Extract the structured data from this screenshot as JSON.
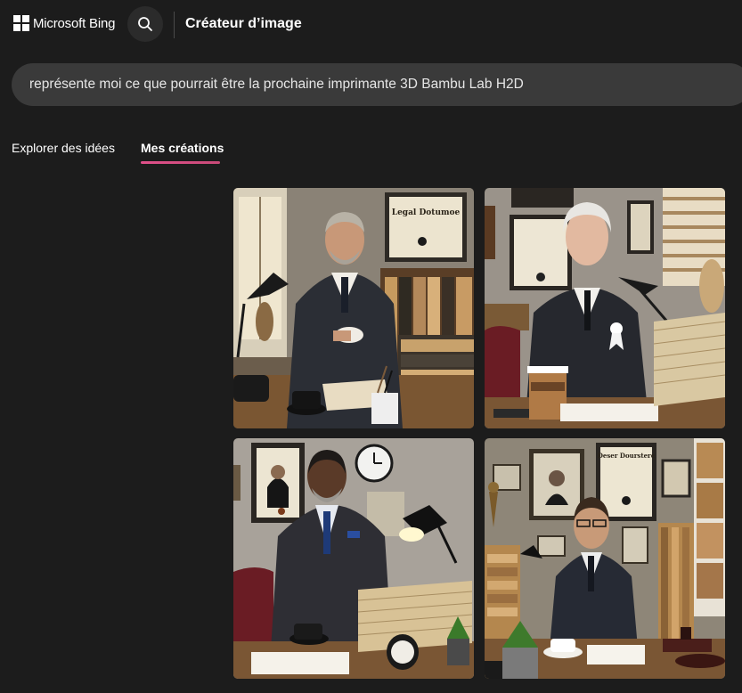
{
  "header": {
    "brand": "Microsoft Bing",
    "title": "Créateur d’image"
  },
  "prompt": {
    "value": "représente moi ce que pourrait être la prochaine imprimante 3D Bambu Lab H2D"
  },
  "tabs": [
    {
      "label": "Explorer des idées",
      "active": false
    },
    {
      "label": "Mes créations",
      "active": true
    }
  ],
  "images": [
    {
      "diploma_text": "Legal Dotumoe"
    },
    {
      "diploma_text": ""
    },
    {
      "diploma_text": ""
    },
    {
      "diploma_text": "Deser Dourstere"
    }
  ],
  "colors": {
    "background": "#1c1c1c",
    "prompt_bar": "#3a3a3a",
    "tab_accent": "#e0508a"
  }
}
